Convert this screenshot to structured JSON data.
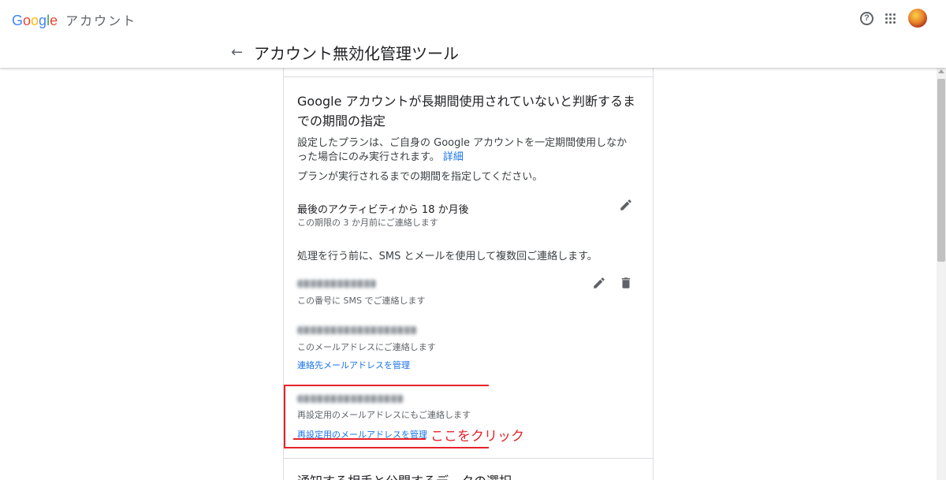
{
  "header": {
    "logo_letters": [
      "G",
      "o",
      "o",
      "g",
      "l",
      "e"
    ],
    "product": "アカウント",
    "help_icon": "question-circle-icon",
    "apps_icon": "apps-grid-icon",
    "back_icon": "arrow-back-icon",
    "page_title": "アカウント無効化管理ツール"
  },
  "section": {
    "heading": "Google アカウントが長期間使用されていないと判断するまでの期間の指定",
    "description": "設定したプランは、ご自身の Google アカウントを一定期間使用しなかった場合にのみ実行されます。",
    "learn_more": "詳細",
    "instruction": "プランが実行されるまでの期間を指定してください。",
    "period": "最後のアクティビティから 18 か月後",
    "period_note": "この期限の 3 か月前にご連絡します",
    "process_note": "処理を行う前に、SMS とメールを使用して複数回ご連絡します。",
    "phone_note": "この番号に SMS でご連絡します",
    "email_note": "このメールアドレスにご連絡します",
    "manage_contact_email": "連絡先メールアドレスを管理",
    "recovery_note": "再設定用のメールアドレスにもご連絡します",
    "manage_recovery_email": "再設定用のメールアドレスを管理",
    "next_section_heading": "通知する相手と公開するデータの選択"
  },
  "annotation": {
    "note": "ここをクリック",
    "color": "#e8222a"
  },
  "colors": {
    "link": "#1a73e8",
    "icon": "#5f6368"
  }
}
